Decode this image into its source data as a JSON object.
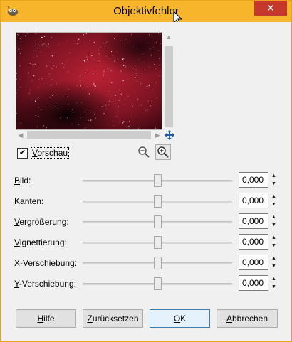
{
  "window": {
    "title": "Objektivfehler",
    "close_glyph": "✕",
    "app_icon": "gimp-wilber-icon"
  },
  "preview": {
    "description_icon": "starfield-nebula-image",
    "checkbox_label": "Vorschau",
    "checkbox_checked": true,
    "checkmark": "✔"
  },
  "params": [
    {
      "accesskey": "B",
      "label_rest": "ild:",
      "value": "0,000"
    },
    {
      "accesskey": "K",
      "label_rest": "anten:",
      "value": "0,000"
    },
    {
      "accesskey": "V",
      "label_rest": "ergrößerung:",
      "value": "0,000"
    },
    {
      "accesskey": "V",
      "label_rest": "ignettierung:",
      "value": "0,000"
    },
    {
      "accesskey": "X",
      "label_rest": "-Verschiebung:",
      "value": "0,000"
    },
    {
      "accesskey": "Y",
      "label_rest": "-Verschiebung:",
      "value": "0,000"
    }
  ],
  "buttons": {
    "help": {
      "accesskey": "H",
      "rest": "ilfe"
    },
    "reset": {
      "accesskey": "Z",
      "rest": "urücksetzen"
    },
    "ok": {
      "accesskey": "O",
      "rest": "K"
    },
    "cancel": {
      "accesskey": "A",
      "rest": "bbrechen"
    }
  },
  "colors": {
    "titlebar": "#f7b52c",
    "close": "#c7382c",
    "default_button_border": "#3c7fb1",
    "nebula": "#b01e32"
  }
}
